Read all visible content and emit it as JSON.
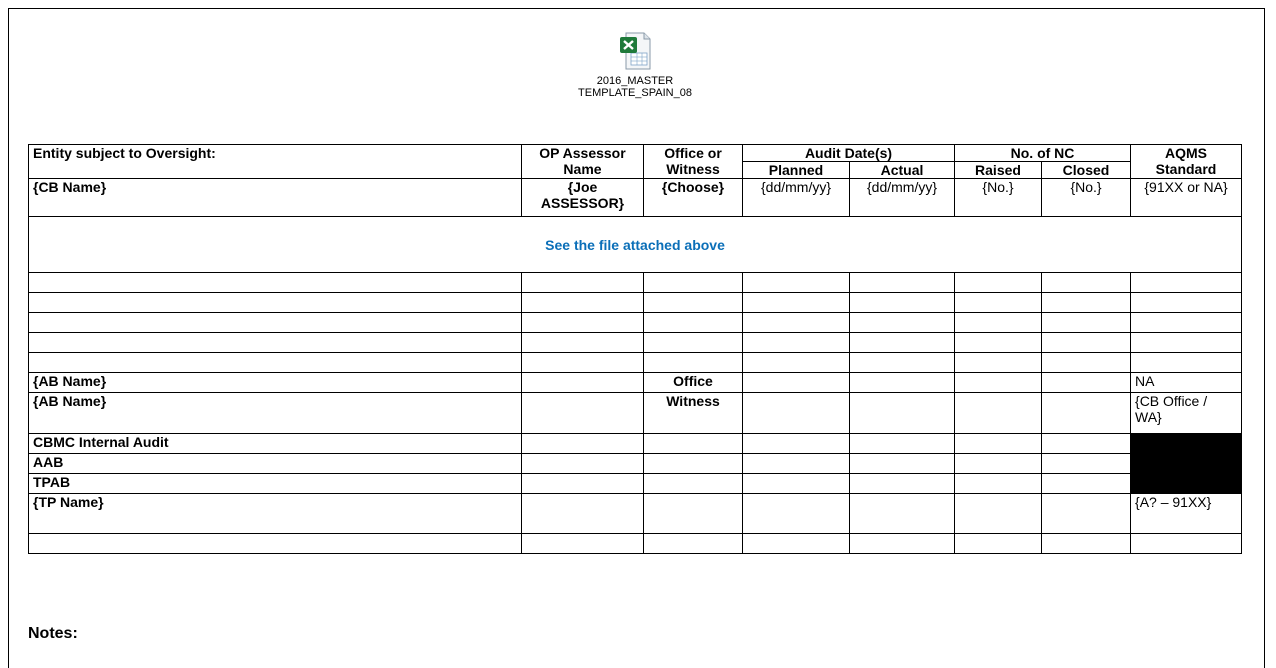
{
  "attachment": {
    "icon": "excel-file-icon",
    "line1": "2016_MASTER",
    "line2": "TEMPLATE_SPAIN_08"
  },
  "headers": {
    "entity": "Entity subject to Oversight:",
    "op": "OP Assessor Name",
    "office": "Office or Witness",
    "audit_dates": "Audit Date(s)",
    "planned": "Planned",
    "actual": "Actual",
    "nc": "No. of NC",
    "raised": "Raised",
    "closed": "Closed",
    "aqms": "AQMS Standard"
  },
  "row_cb": {
    "entity": "{CB Name}",
    "op": "{Joe ASSESSOR}",
    "office": "{Choose}",
    "planned": "{dd/mm/yy}",
    "actual": "{dd/mm/yy}",
    "raised": "{No.}",
    "closed": "{No.}",
    "aqms": "{91XX or NA}"
  },
  "banner": "See the file attached above",
  "row_ab1": {
    "entity": "{AB Name}",
    "office": "Office",
    "aqms": "NA"
  },
  "row_ab2": {
    "entity": "{AB Name}",
    "office": "Witness",
    "aqms": "{CB Office / WA}"
  },
  "cbmc": "CBMC Internal Audit",
  "aab": "AAB",
  "tpab": "TPAB",
  "row_tp": {
    "entity": "{TP Name}",
    "aqms": "{A? – 91XX}"
  },
  "notes": "Notes:"
}
